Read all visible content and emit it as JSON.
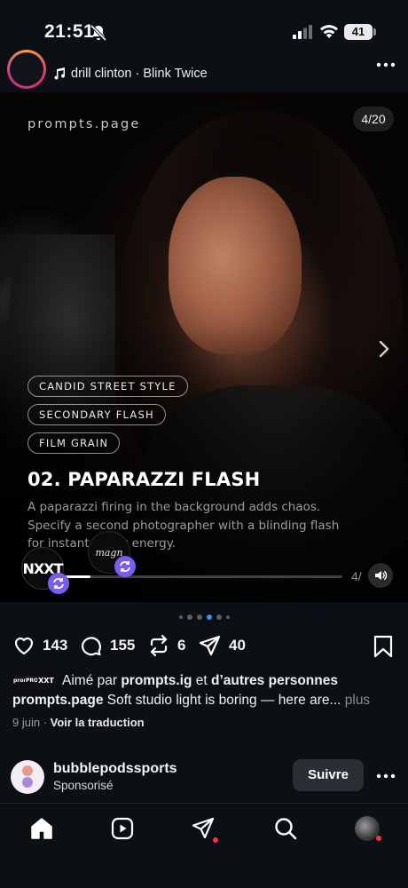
{
  "status": {
    "time": "21:51",
    "battery": "41"
  },
  "post": {
    "audio": "drill clinton · Blink Twice",
    "slide": {
      "watermark": "prompts.page",
      "counter": "4/20",
      "tags": [
        "CANDID STREET STYLE",
        "SECONDARY FLASH",
        "FILM GRAIN"
      ],
      "title": "02. PAPARAZZI FLASH",
      "description": "A paparazzi firing in the background adds chaos. Specify a second photographer with a blinding flash for instant street energy.",
      "badge_left": "NXXT",
      "badge_right": "magn",
      "mini_counter": "4/",
      "progress": 0.09
    },
    "carousel_dots": 6,
    "active_dot": 3,
    "likes": "143",
    "comments": "155",
    "reposts": "6",
    "shares": "40",
    "liked_by": {
      "prefix": "Aimé par",
      "user": "prompts.ig",
      "connector": "et",
      "others": "d’autres personnes"
    },
    "mini_avatars": [
      "prompts",
      "PROMPTS",
      "XXT"
    ],
    "caption": {
      "user": "prompts.page",
      "text": "Soft studio light is boring — here are...",
      "more": "plus"
    },
    "date": "9 juin",
    "translate": "Voir la traduction"
  },
  "sponsored": {
    "name": "bubblepodssports",
    "label": "Sponsorisé",
    "follow": "Suivre"
  },
  "colors": {
    "accent": "#3f8cff",
    "remix": "#7b5cf0",
    "notification": "#ff3040"
  },
  "nav": {
    "items": [
      "home-icon",
      "reels-icon",
      "direct-icon",
      "search-icon",
      "profile-avatar"
    ]
  }
}
